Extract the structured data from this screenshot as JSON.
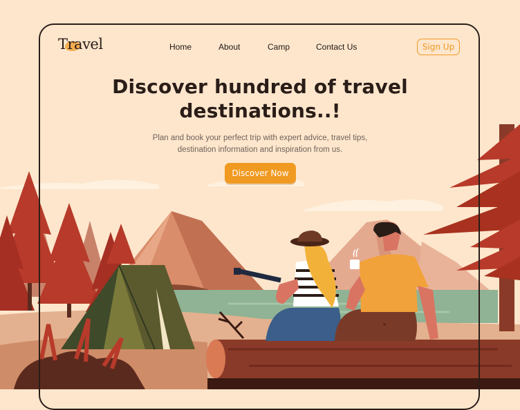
{
  "header": {
    "logo_text": "Travel",
    "nav": [
      "Home",
      "About",
      "Camp",
      "Contact Us"
    ],
    "signup_label": "Sign Up"
  },
  "hero": {
    "title_line1": "Discover hundred of travel",
    "title_line2": "destinations..!",
    "subtitle_line1": "Plan and book your perfect trip with expert advice, travel tips,",
    "subtitle_line2": "destination information and inspiration from us.",
    "cta_label": "Discover Now"
  },
  "colors": {
    "background": "#fde6cc",
    "accent": "#f09a22",
    "text_dark": "#2a1d18",
    "tree_red": "#b83a2a",
    "lake_green": "#8fb394",
    "tent_green": "#5b5a2e"
  },
  "icons": [
    "tent-icon",
    "guitar-icon",
    "coffee-mug-icon",
    "hat-icon"
  ]
}
